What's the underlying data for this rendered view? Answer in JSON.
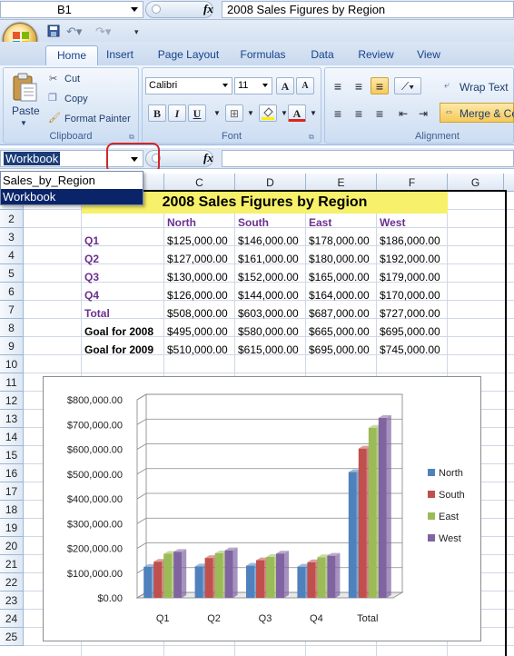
{
  "top_bar": {
    "name_box": "B1",
    "formula": "2008 Sales Figures by Region",
    "fx_label": "fx"
  },
  "tabs": [
    "Home",
    "Insert",
    "Page Layout",
    "Formulas",
    "Data",
    "Review",
    "View"
  ],
  "ribbon": {
    "clipboard": {
      "paste": "Paste",
      "cut": "Cut",
      "copy": "Copy",
      "format_painter": "Format Painter",
      "label": "Clipboard"
    },
    "font": {
      "name": "Calibri",
      "size": "11",
      "bold": "B",
      "italic": "I",
      "underline": "U",
      "grow": "A",
      "shrink": "A",
      "font_color": "A",
      "label": "Font"
    },
    "alignment": {
      "wrap_text": "Wrap Text",
      "merge": "Merge & Ce",
      "label": "Alignment"
    }
  },
  "name_row": {
    "name_box": "Workbook",
    "fx_label": "fx",
    "formula": ""
  },
  "name_dropdown": {
    "items": [
      "Sales_by_Region",
      "Workbook"
    ],
    "selected": "Workbook"
  },
  "columns": [
    "C",
    "D",
    "E",
    "F",
    "G"
  ],
  "rows": [
    "1",
    "2",
    "3",
    "4",
    "5",
    "6",
    "7",
    "8",
    "9",
    "10",
    "11",
    "12",
    "13",
    "14",
    "15",
    "16",
    "17",
    "18",
    "19",
    "20",
    "21",
    "22",
    "23",
    "24",
    "25"
  ],
  "sheet": {
    "title": "2008 Sales Figures by Region",
    "headers": [
      "North",
      "South",
      "East",
      "West"
    ],
    "data_rows": [
      {
        "label": "Q1",
        "values": [
          "$125,000.00",
          "$146,000.00",
          "$178,000.00",
          "$186,000.00"
        ]
      },
      {
        "label": "Q2",
        "values": [
          "$127,000.00",
          "$161,000.00",
          "$180,000.00",
          "$192,000.00"
        ]
      },
      {
        "label": "Q3",
        "values": [
          "$130,000.00",
          "$152,000.00",
          "$165,000.00",
          "$179,000.00"
        ]
      },
      {
        "label": "Q4",
        "values": [
          "$126,000.00",
          "$144,000.00",
          "$164,000.00",
          "$170,000.00"
        ]
      },
      {
        "label": "Total",
        "values": [
          "$508,000.00",
          "$603,000.00",
          "$687,000.00",
          "$727,000.00"
        ]
      },
      {
        "label": "Goal for 2008",
        "values": [
          "$495,000.00",
          "$580,000.00",
          "$665,000.00",
          "$695,000.00"
        ]
      },
      {
        "label": "Goal for 2009",
        "values": [
          "$510,000.00",
          "$615,000.00",
          "$695,000.00",
          "$745,000.00"
        ]
      }
    ]
  },
  "colors": {
    "north": "#4f81bd",
    "south": "#c0504d",
    "east": "#9bbb59",
    "west": "#8064a2",
    "label_purple": "#6b2f8e",
    "title_fill": "#f7f06a"
  },
  "chart_data": {
    "type": "bar",
    "categories": [
      "Q1",
      "Q2",
      "Q3",
      "Q4",
      "Total"
    ],
    "series": [
      {
        "name": "North",
        "values": [
          125000,
          127000,
          130000,
          126000,
          508000
        ]
      },
      {
        "name": "South",
        "values": [
          146000,
          161000,
          152000,
          144000,
          603000
        ]
      },
      {
        "name": "East",
        "values": [
          178000,
          180000,
          165000,
          164000,
          687000
        ]
      },
      {
        "name": "West",
        "values": [
          186000,
          192000,
          179000,
          170000,
          727000
        ]
      }
    ],
    "yticks": [
      "$0.00",
      "$100,000.00",
      "$200,000.00",
      "$300,000.00",
      "$400,000.00",
      "$500,000.00",
      "$600,000.00",
      "$700,000.00",
      "$800,000.00"
    ],
    "ylim": [
      0,
      800000
    ],
    "grid": true,
    "legend": "right",
    "style": "3d-clustered-column"
  }
}
